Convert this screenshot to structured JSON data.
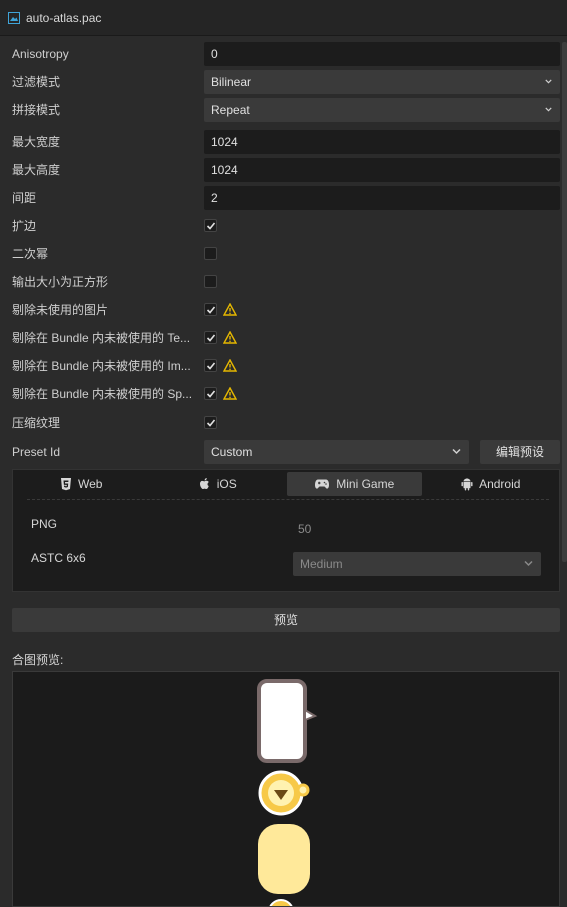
{
  "window": {
    "title": "auto-atlas.pac"
  },
  "properties": {
    "anisotropy": {
      "label": "Anisotropy",
      "value": "0"
    },
    "filter_mode": {
      "label": "过滤模式",
      "value": "Bilinear"
    },
    "wrap_mode": {
      "label": "拼接模式",
      "value": "Repeat"
    },
    "max_width": {
      "label": "最大宽度",
      "value": "1024"
    },
    "max_height": {
      "label": "最大高度",
      "value": "1024"
    },
    "padding": {
      "label": "间距",
      "value": "2"
    },
    "allow_rotation": {
      "label": "扩边",
      "checked": true
    },
    "power_of_two": {
      "label": "二次幂",
      "checked": false
    },
    "force_squared": {
      "label": "输出大小为正方形",
      "checked": false
    },
    "remove_unused_images": {
      "label": "剔除未使用的图片",
      "checked": true,
      "warning": true
    },
    "remove_unused_textures": {
      "label": "剔除在 Bundle 内未被使用的 Te...",
      "checked": true,
      "warning": true
    },
    "remove_unused_image_assets": {
      "label": "剔除在 Bundle 内未被使用的 Im...",
      "checked": true,
      "warning": true
    },
    "remove_unused_sprites": {
      "label": "剔除在 Bundle 内未被使用的 Sp...",
      "checked": true,
      "warning": true
    },
    "compress_texture": {
      "label": "压缩纹理",
      "checked": true
    },
    "preset_id": {
      "label": "Preset Id",
      "value": "Custom",
      "edit_button": "编辑预设"
    }
  },
  "platforms": {
    "tabs": [
      {
        "label": "Web",
        "icon": "html5-icon"
      },
      {
        "label": "iOS",
        "icon": "apple-icon"
      },
      {
        "label": "Mini Game",
        "icon": "gamepad-icon",
        "active": true
      },
      {
        "label": "Android",
        "icon": "android-icon"
      }
    ],
    "formats": [
      {
        "label": "PNG",
        "value": "50"
      },
      {
        "label": "ASTC 6x6",
        "value": "Medium"
      }
    ]
  },
  "preview_button": "预览",
  "atlas_preview_label": "合图预览:",
  "colors": {
    "accent_warning": "#e6b800",
    "active_tab": "#3a3a3a"
  }
}
